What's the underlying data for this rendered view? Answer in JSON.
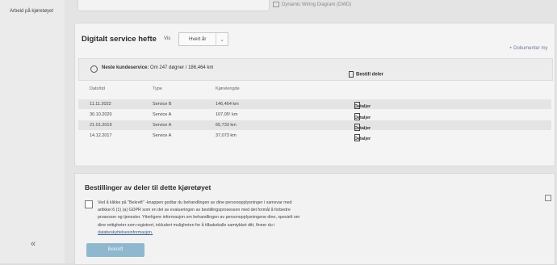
{
  "sidebar": {
    "link_label": "Arbeid på kjøretøyet",
    "collapse_icon": "«"
  },
  "header": {
    "wiring_label": "Dynamic Wiring Diagram (DWD)"
  },
  "service": {
    "title": "Digitalt service hefte",
    "vis_label": "Vis",
    "interval_value": "Hvert år",
    "interval_chevron": "⌄",
    "doc_link": "+ Dokumenter my",
    "next_label": "Neste kundeservice:",
    "next_value": " Om 247 døgner / 186,464 km",
    "order_parts": "Bestill deler",
    "columns": [
      "Dato/tid",
      "Type",
      "Kjørelengde"
    ],
    "detail_label": "Detaljer",
    "rows": [
      {
        "date": "11.11.2022",
        "type": "Service B",
        "km": "146,464 km"
      },
      {
        "date": "30.10.2020",
        "type": "Service A",
        "km": "107,05¹ km"
      },
      {
        "date": "21.01.2019",
        "type": "Service A",
        "km": "65,733 km"
      },
      {
        "date": "14.12.2017",
        "type": "Service A",
        "km": "37,073 km"
      }
    ]
  },
  "orders": {
    "title": "Bestillinger av deler til dette kjøretøyet",
    "consent_text": "Ved å klikke på \"Bekreft\" -knappen godtar du behandlingen av dine personopplysninger i samsvar med artikkel 6 (1) (a) GDPR som en del av evalueringen av bestillingsprosessen med det formål å forbedre prosesser og tjenester. Ytterligere informasjon om behandlingen av personopplysningene dine, spesielt om dine rettigheter som registrert, inkludert muligheten for å tilbakekalle samtykket ditt, finner du i",
    "consent_link": "databeskyttelsesinformasjon.",
    "confirm_label": "Bekreft"
  }
}
